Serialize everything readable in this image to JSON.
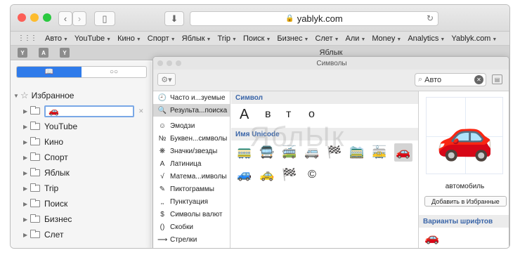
{
  "browser": {
    "url": "yablyk.com",
    "tab_title": "Яблык",
    "tab_icons": [
      "Y",
      "A",
      "Y"
    ]
  },
  "favorites_bar": [
    "Авто",
    "YouTube",
    "Кино",
    "Спорт",
    "Яблык",
    "Trip",
    "Поиск",
    "Бизнес",
    "Слет",
    "Али",
    "Money",
    "Analytics",
    "Yablyk.com"
  ],
  "sidebar": {
    "root_label": "Избранное",
    "editing_value": "🚗",
    "folders": [
      "YouTube",
      "Кино",
      "Спорт",
      "Яблык",
      "Trip",
      "Поиск",
      "Бизнес",
      "Слет"
    ]
  },
  "palette": {
    "title": "Символы",
    "search_value": "Авто",
    "categories": [
      {
        "icon": "🕘",
        "label": "Часто и...зуемые"
      },
      {
        "icon": "🔍",
        "label": "Результа...поиска"
      },
      {
        "icon": "☺",
        "label": "Эмодзи"
      },
      {
        "icon": "№",
        "label": "Буквен...символы"
      },
      {
        "icon": "❋",
        "label": "Значки/звезды"
      },
      {
        "icon": "A",
        "label": "Латиница"
      },
      {
        "icon": "√",
        "label": "Матема...имволы"
      },
      {
        "icon": "✎",
        "label": "Пиктограммы"
      },
      {
        "icon": "‚‚",
        "label": "Пунктуация"
      },
      {
        "icon": "$",
        "label": "Символы валют"
      },
      {
        "icon": "()",
        "label": "Скобки"
      },
      {
        "icon": "⟶",
        "label": "Стрелки"
      }
    ],
    "section_symbol": "Символ",
    "letters": [
      "А",
      "в",
      "т",
      "о"
    ],
    "section_unicode": "Имя Unicode",
    "emoji_row1": [
      "🚃",
      "🚍",
      "🚎",
      "🚐",
      "🏁",
      "🚞",
      "🚋",
      "🚗"
    ],
    "emoji_row2": [
      "🚙",
      "🚕",
      "🏁",
      "©"
    ],
    "preview_char": "🚗",
    "char_name": "автомобиль",
    "add_favorites": "Добавить в Избранные",
    "font_variants_head": "Варианты шрифтов",
    "variant_char": "🚗"
  },
  "watermark": "ЯблЫк",
  "colors": {
    "accent": "#2f7bea",
    "section_heading": "#3a65a8"
  }
}
